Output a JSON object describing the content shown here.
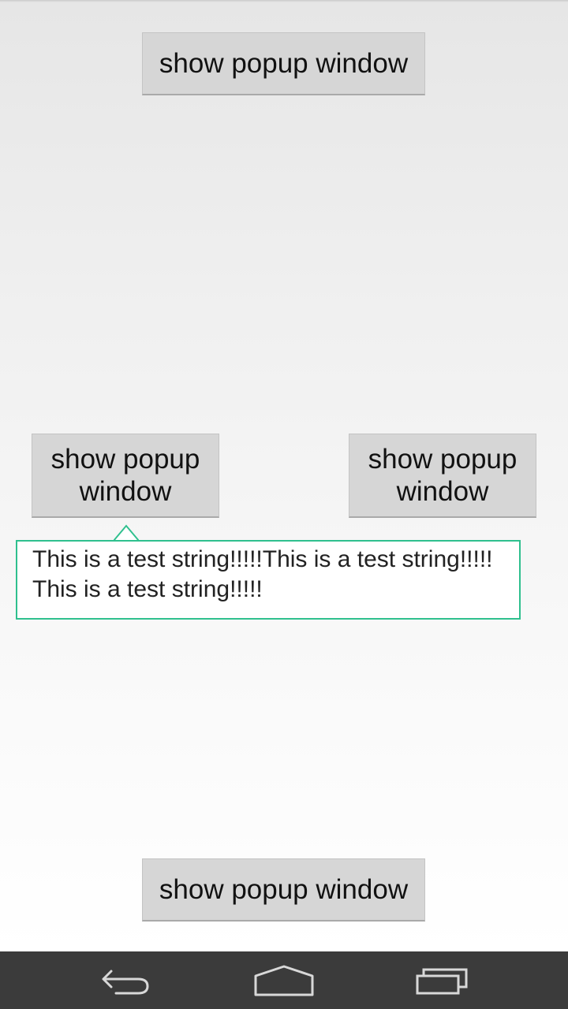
{
  "buttons": {
    "top": "show popup window",
    "middle_left": "show popup window",
    "middle_right": "show popup window",
    "bottom": "show popup window"
  },
  "popup": {
    "text": "This is a test string!!!!!This is a test string!!!!!This is a test string!!!!!"
  },
  "colors": {
    "popup_border": "#2fc08e",
    "button_bg": "#d6d6d6",
    "navbar_bg": "#3b3b3b"
  },
  "navbar": {
    "icons": [
      "back-icon",
      "home-icon",
      "recent-apps-icon"
    ]
  }
}
